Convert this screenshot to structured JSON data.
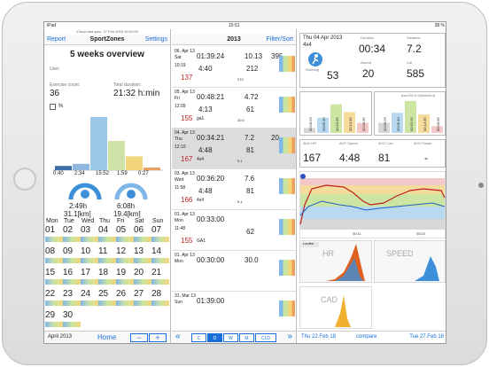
{
  "status": {
    "device": "iPad",
    "time": "15:51",
    "battery": "38 %"
  },
  "left": {
    "sync": "iCloud last sync: 27 Feb 2018 16:51:05",
    "report": "Report",
    "title": "SportZones",
    "settings": "Settings",
    "overview": "5 weeks overview",
    "user": "User:",
    "ex_label": "Exercise count:",
    "ex_val": "36",
    "dur_label": "Total duration:",
    "dur_val": "21:32 h:min",
    "percent": "%",
    "hist_vals": [
      0.08,
      0.12,
      1.0,
      0.55,
      0.26,
      0.05
    ],
    "hist_labels": [
      "0:40",
      "2:34",
      "15:52",
      "1:59",
      "0:27"
    ],
    "g1_time": "2:49h",
    "g1_dist": "31.1[km]",
    "g2_time": "6:08h",
    "g2_dist": "19.4[km]",
    "weekdays": [
      "Mon",
      "Tue",
      "Wed",
      "Thu",
      "Fri",
      "Sat",
      "Sun"
    ],
    "weeks": [
      [
        "01",
        "02",
        "03",
        "04",
        "05",
        "06",
        "07"
      ],
      [
        "08",
        "09",
        "10",
        "11",
        "12",
        "13",
        "14"
      ],
      [
        "15",
        "16",
        "17",
        "18",
        "19",
        "20",
        "21"
      ],
      [
        "22",
        "23",
        "24",
        "25",
        "26",
        "27",
        "28"
      ],
      [
        "29",
        "30",
        "",
        "",
        "",
        "",
        ""
      ]
    ],
    "month": "April 2013",
    "home": "Home",
    "minus": "−",
    "plus": "+"
  },
  "mid": {
    "year": "2013",
    "filter": "Filter/Sort",
    "acts": [
      {
        "d1": "06. Apr 13",
        "d2": "Sat",
        "d3": "10:19",
        "time": "01:39:24",
        "dist": "10.13",
        "avg": "4:40",
        "hr": "137",
        "elev": "395",
        "note": "",
        "ex": "212",
        "x": "272"
      },
      {
        "d1": "05. Apr 13",
        "d2": "Fri",
        "d3": "12:09",
        "time": "00:48:21",
        "dist": "4.72",
        "avg": "4:13",
        "hr": "155",
        "elev": "",
        "note": "ga1",
        "ex": "61",
        "x": "10.0"
      },
      {
        "d1": "04. Apr 13",
        "d2": "Thu",
        "d3": "12:10",
        "time": "00:34:21",
        "dist": "7.2",
        "avg": "4:48",
        "hr": "167",
        "elev": "20",
        "note": "4x4",
        "ex": "81",
        "x": "9.1"
      },
      {
        "d1": "03. Apr 13",
        "d2": "Wed",
        "d3": "11:58",
        "time": "00:36:20",
        "dist": "7.6",
        "avg": "4:48",
        "hr": "166",
        "elev": "",
        "note": "4x4",
        "ex": "81",
        "x": "9.1"
      },
      {
        "d1": "01. Apr 13",
        "d2": "Mon",
        "d3": "11:48",
        "time": "00:33:00",
        "dist": "",
        "avg": "",
        "hr": "155",
        "elev": "",
        "note": "GA1",
        "ex": "62",
        "x": ""
      },
      {
        "d1": "01. Apr 13",
        "d2": "Mon",
        "d3": "",
        "time": "00:30:00",
        "dist": "30.0",
        "avg": "",
        "hr": "",
        "elev": "",
        "note": "",
        "ex": "",
        "x": ""
      },
      {
        "d1": "31. Mar 13",
        "d2": "Sun",
        "d3": "",
        "time": "01:39:00",
        "dist": "",
        "avg": "",
        "hr": "",
        "elev": "",
        "note": "",
        "ex": "",
        "x": ""
      }
    ],
    "seg": [
      "C",
      "D",
      "W",
      "M",
      "CLD"
    ],
    "prev": "«",
    "next": "»"
  },
  "right": {
    "date": "Thu 04 Apr 2013",
    "sport": "Running",
    "desc": "4x4",
    "ex_count": "53",
    "duration": "00:34",
    "ascent": "20",
    "distance": "7.2",
    "cal": "585",
    "pwc": "pwc150  6:34[min/km]",
    "avg_hr": "167",
    "avg_speed": "4:48",
    "avg_cad": "81",
    "avg_power": "-",
    "run_label": "Laufen",
    "hr_lbl": "HR",
    "speed_lbl": "SPEED",
    "cad_lbl": "CAD",
    "time1": "00:11",
    "time2": "00:22",
    "d1": "Thu 22.Feb 18",
    "compare": "compare",
    "d2": "Tue 27.Feb 18",
    "zone_vals": [
      0.15,
      0.45,
      0.85,
      0.62,
      0.3
    ],
    "zone_labels": [
      "00:00:23",
      "00:05:30",
      "00:15:25",
      "00:13:35",
      "00:00:39"
    ]
  }
}
